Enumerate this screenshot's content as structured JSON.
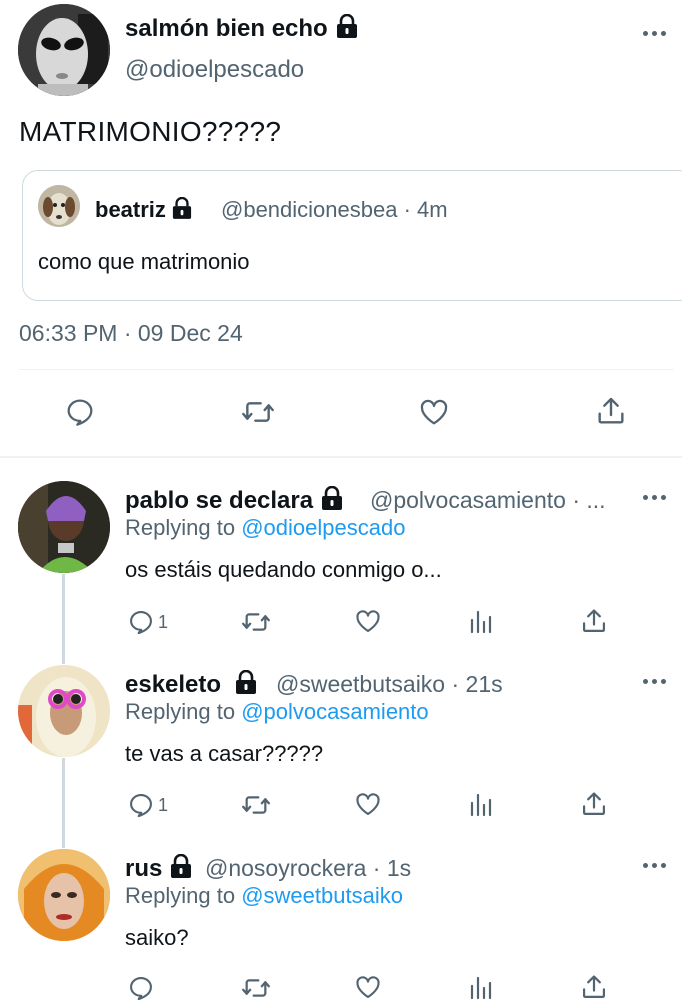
{
  "main_tweet": {
    "display_name": "salmón bien echo",
    "handle": "@odioelpescado",
    "text": "MATRIMONIO?????",
    "timestamp": "06:33 PM · 09 Dec 24",
    "quoted": {
      "display_name": "beatriz",
      "handle_time": "@bendicionesbea · 4m",
      "text": "como que matrimonio"
    }
  },
  "replies": [
    {
      "display_name": "pablo se declara",
      "handle_time": "@polvocasamiento · ...",
      "replying_label": "Replying to",
      "replying_to": "@odioelpescado",
      "text": "os estáis quedando conmigo o...",
      "reply_count": "1"
    },
    {
      "display_name": "eskeleto",
      "handle_time": "@sweetbutsaiko · 21s",
      "replying_label": "Replying to",
      "replying_to": "@polvocasamiento",
      "text": "te vas a casar?????",
      "reply_count": "1"
    },
    {
      "display_name": "rus",
      "handle_time": "@nosoyrockera · 1s",
      "replying_label": "Replying to",
      "replying_to": "@sweetbutsaiko",
      "text": "saiko?",
      "reply_count": ""
    }
  ],
  "icons": [
    "lock-icon",
    "more-icon",
    "reply-icon",
    "retweet-icon",
    "like-icon",
    "share-icon",
    "views-icon"
  ],
  "colors": {
    "link": "#1d9bf0",
    "secondary_text": "#536471",
    "divider": "#eff3f4"
  }
}
